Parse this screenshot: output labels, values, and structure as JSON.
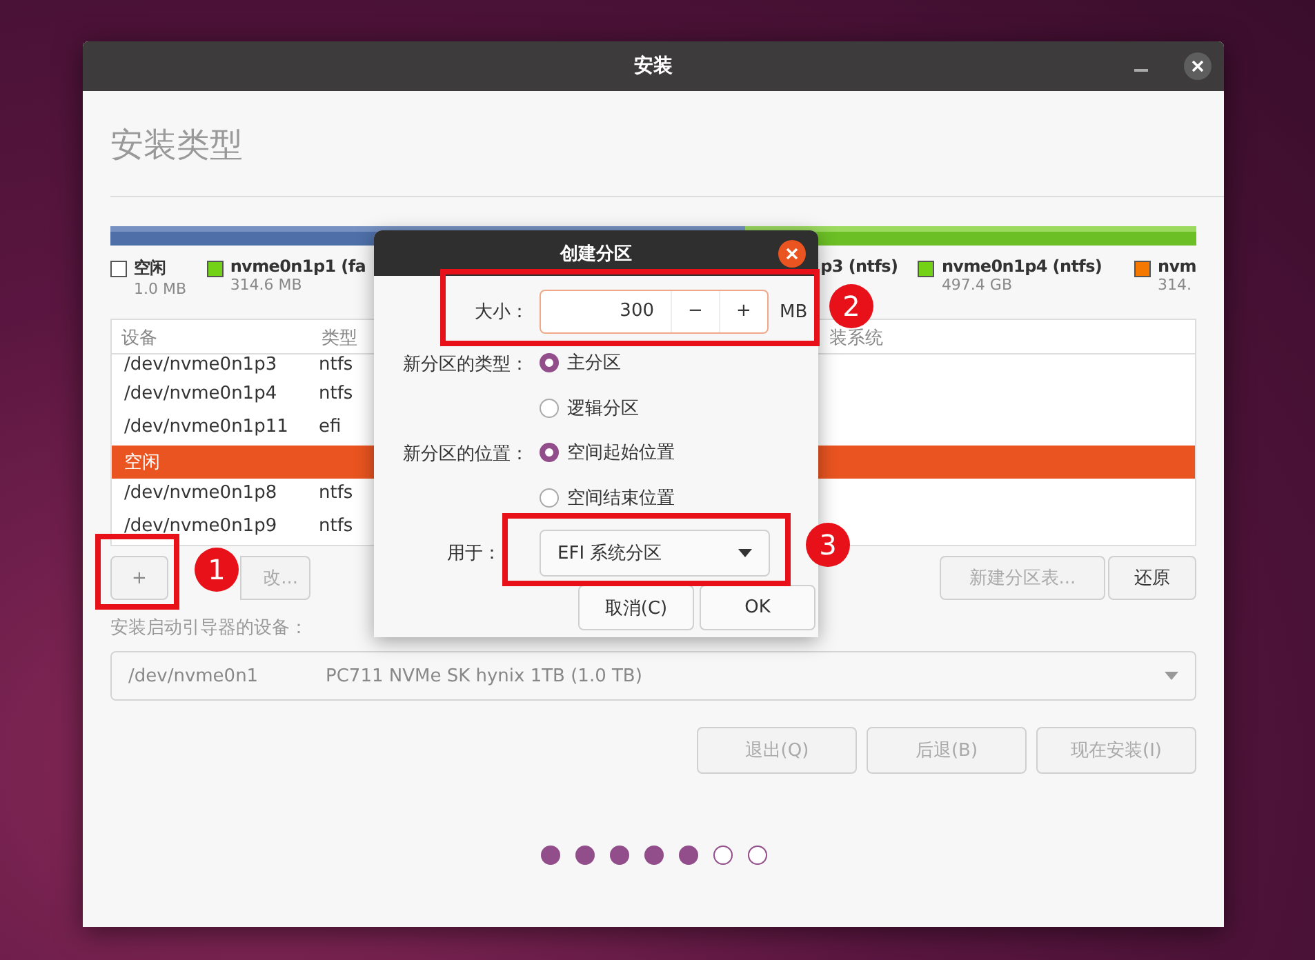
{
  "window": {
    "title": "安装"
  },
  "heading": "安装类型",
  "legend": [
    {
      "name": "空闲",
      "size": "1.0 MB",
      "color": "#ffffff"
    },
    {
      "name": "nvme0n1p1 (fa",
      "size": "314.6 MB",
      "color": "#73d216"
    },
    {
      "name": "p3 (ntfs)"
    },
    {
      "name": "nvme0n1p4 (ntfs)",
      "size": "497.4 GB",
      "color": "#73d216"
    },
    {
      "name": "nvm",
      "size": "314.",
      "color": "#f57900"
    }
  ],
  "table": {
    "columns": [
      "设备",
      "类型",
      "装系统"
    ],
    "rows": [
      {
        "device": "/dev/nvme0n1p3",
        "type": "ntfs",
        "selected": false
      },
      {
        "device": "/dev/nvme0n1p4",
        "type": "ntfs",
        "selected": false
      },
      {
        "device": "/dev/nvme0n1p11",
        "type": "efi",
        "selected": false
      },
      {
        "device": "空闲",
        "type": "",
        "selected": true
      },
      {
        "device": "/dev/nvme0n1p8",
        "type": "ntfs",
        "selected": false
      },
      {
        "device": "/dev/nvme0n1p9",
        "type": "ntfs",
        "selected": false
      }
    ]
  },
  "partition_buttons": {
    "add": "+",
    "change": "改...",
    "new_table": "新建分区表...",
    "revert": "还原"
  },
  "bootloader": {
    "label": "安装启动引导器的设备：",
    "device": "/dev/nvme0n1",
    "description": "PC711 NVMe SK hynix 1TB (1.0 TB)"
  },
  "buttons": [
    "退出(Q)",
    "后退(B)",
    "现在安装(I)"
  ],
  "steps": [
    {
      "done": true
    },
    {
      "done": true
    },
    {
      "done": true
    },
    {
      "done": true
    },
    {
      "done": true
    },
    {
      "done": false
    },
    {
      "done": false
    }
  ],
  "dialog": {
    "title": "创建分区",
    "size_label": "大小：",
    "size_value": "300",
    "minus": "−",
    "plus": "+",
    "unit": "MB",
    "type_label": "新分区的类型：",
    "types": [
      {
        "label": "主分区",
        "selected": true
      },
      {
        "label": "逻辑分区",
        "selected": false
      }
    ],
    "location_label": "新分区的位置：",
    "locations": [
      {
        "label": "空间起始位置",
        "selected": true
      },
      {
        "label": "空间结束位置",
        "selected": false
      }
    ],
    "use_label": "用于：",
    "use_value": "EFI 系统分区",
    "cancel": "取消(C)",
    "ok": "OK"
  },
  "annotations": [
    {
      "label": "1"
    },
    {
      "label": "2"
    },
    {
      "label": "3"
    }
  ]
}
